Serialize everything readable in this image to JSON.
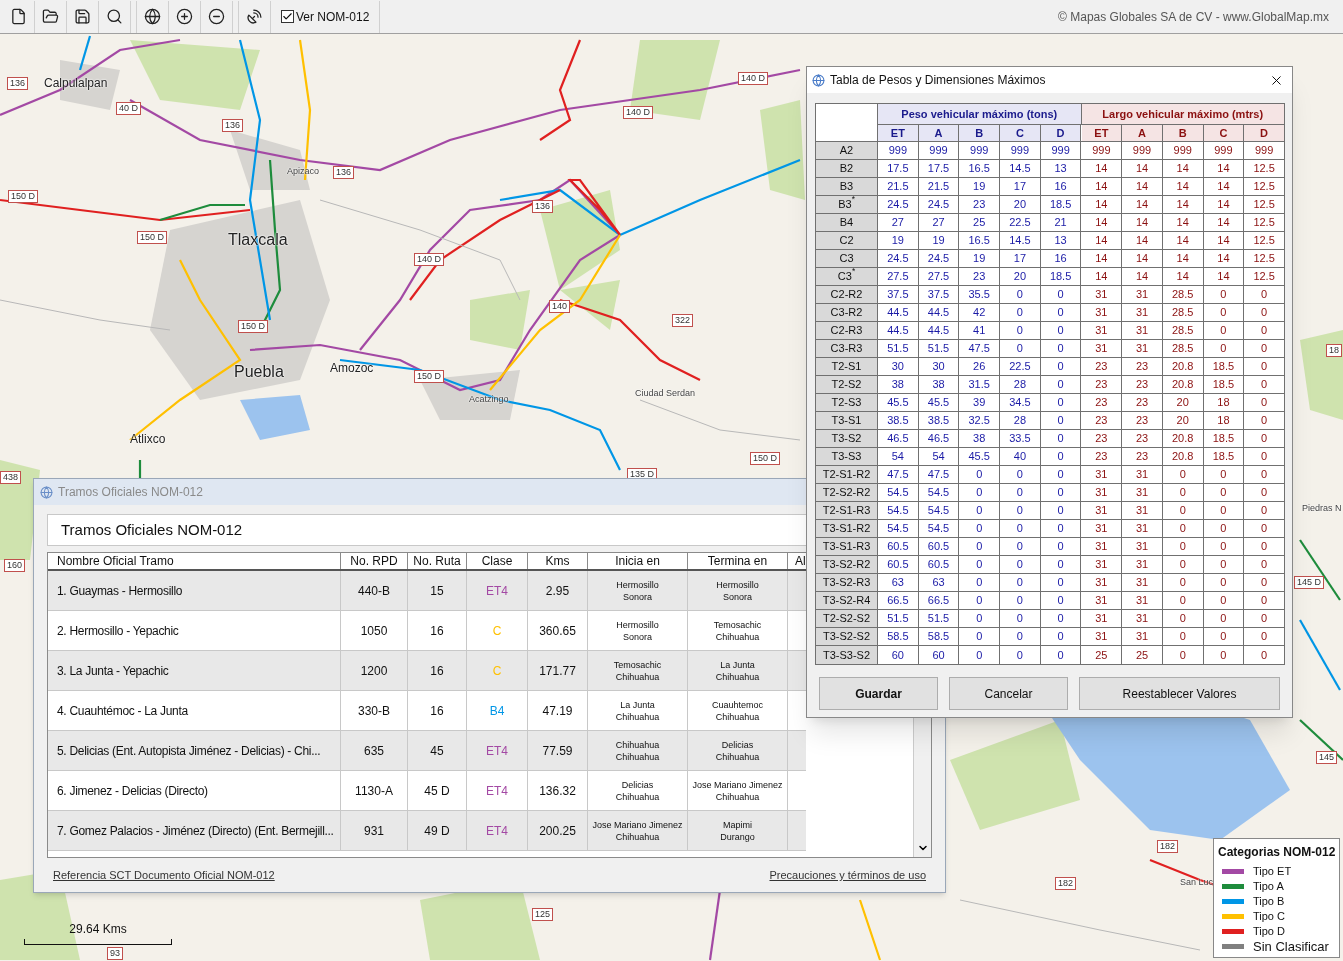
{
  "toolbar": {
    "checkbox": {
      "label": "Ver NOM-012",
      "checked": true
    },
    "copyright": "© Mapas Globales SA de CV - www.GlobalMap.mx"
  },
  "map": {
    "labels": [
      {
        "kind": "city",
        "text": "Calpulalpan"
      },
      {
        "kind": "bigcity",
        "text": "Tlaxcala"
      },
      {
        "kind": "bigcity",
        "text": "Puebla"
      },
      {
        "kind": "city",
        "text": "Amozoc"
      },
      {
        "kind": "city",
        "text": "Atlixco"
      },
      {
        "kind": "town",
        "text": "Apizaco"
      },
      {
        "kind": "town",
        "text": "Acatzingo"
      },
      {
        "kind": "town",
        "text": "Ciudad Serdan"
      },
      {
        "kind": "town",
        "text": "Piedras N"
      },
      {
        "kind": "town",
        "text": "San Luc"
      },
      {
        "kind": "shield",
        "text": "136"
      },
      {
        "kind": "shield",
        "text": "40 D"
      },
      {
        "kind": "shield",
        "text": "136"
      },
      {
        "kind": "shield",
        "text": "136"
      },
      {
        "kind": "shield",
        "text": "140 D"
      },
      {
        "kind": "shield",
        "text": "140 D"
      },
      {
        "kind": "shield",
        "text": "150 D"
      },
      {
        "kind": "shield",
        "text": "150 D"
      },
      {
        "kind": "shield",
        "text": "136"
      },
      {
        "kind": "shield",
        "text": "140 D"
      },
      {
        "kind": "shield",
        "text": "150 D"
      },
      {
        "kind": "shield",
        "text": "140"
      },
      {
        "kind": "shield",
        "text": "322"
      },
      {
        "kind": "shield",
        "text": "150 D"
      },
      {
        "kind": "shield",
        "text": "150 D"
      },
      {
        "kind": "shield",
        "text": "135 D"
      },
      {
        "kind": "shield",
        "text": "438"
      },
      {
        "kind": "shield",
        "text": "160"
      },
      {
        "kind": "shield",
        "text": "125"
      },
      {
        "kind": "shield",
        "text": "93"
      },
      {
        "kind": "shield",
        "text": "182"
      },
      {
        "kind": "shield",
        "text": "182"
      },
      {
        "kind": "shield",
        "text": "145 D"
      },
      {
        "kind": "shield",
        "text": "145"
      },
      {
        "kind": "shield",
        "text": "18"
      }
    ],
    "scale": "29.64 Kms"
  },
  "legend": {
    "title": "Categorias NOM-012",
    "items": [
      {
        "label": "Tipo ET",
        "color": "#a349a4"
      },
      {
        "label": "Tipo A",
        "color": "#1e8c3c"
      },
      {
        "label": "Tipo B",
        "color": "#0096e6"
      },
      {
        "label": "Tipo C",
        "color": "#ffc000"
      },
      {
        "label": "Tipo D",
        "color": "#e02020"
      },
      {
        "label": "Sin Clasificar",
        "color": "#808080"
      }
    ]
  },
  "tramos_window": {
    "title": "Tramos Oficiales NOM-012",
    "heading": "Tramos Oficiales NOM-012",
    "columns": [
      "Nombre Oficial Tramo",
      "No. RPD",
      "No. Ruta",
      "Clase",
      "Kms",
      "Inicia en",
      "Termina en",
      "Al"
    ],
    "rows": [
      {
        "name": "1.  Guaymas - Hermosillo",
        "rpd": "440-B",
        "ruta": "15",
        "clase": "ET4",
        "color": "#a349a4",
        "kms": "2.95",
        "inicia": [
          "Hermosillo",
          "Sonora"
        ],
        "termina": [
          "Hermosillo",
          "Sonora"
        ]
      },
      {
        "name": "2.  Hermosillo - Yepachic",
        "rpd": "1050",
        "ruta": "16",
        "clase": "C",
        "color": "#ffc000",
        "kms": "360.65",
        "inicia": [
          "Hermosillo",
          "Sonora"
        ],
        "termina": [
          "Temosachic",
          "Chihuahua"
        ]
      },
      {
        "name": "3.  La Junta - Yepachic",
        "rpd": "1200",
        "ruta": "16",
        "clase": "C",
        "color": "#ffc000",
        "kms": "171.77",
        "inicia": [
          "Temosachic",
          "Chihuahua"
        ],
        "termina": [
          "La Junta",
          "Chihuahua"
        ]
      },
      {
        "name": "4.  Cuauhtémoc - La Junta",
        "rpd": "330-B",
        "ruta": "16",
        "clase": "B4",
        "color": "#0096e6",
        "kms": "47.19",
        "inicia": [
          "La Junta",
          "Chihuahua"
        ],
        "termina": [
          "Cuauhtemoc",
          "Chihuahua"
        ]
      },
      {
        "name": "5.  Delicias (Ent. Autopista Jiménez - Delicias) - Chi...",
        "rpd": "635",
        "ruta": "45",
        "clase": "ET4",
        "color": "#a349a4",
        "kms": "77.59",
        "inicia": [
          "Chihuahua",
          "Chihuahua"
        ],
        "termina": [
          "Delicias",
          "Chihuahua"
        ]
      },
      {
        "name": "6.  Jimenez - Delicias (Directo)",
        "rpd": "1130-A",
        "ruta": "45 D",
        "clase": "ET4",
        "color": "#a349a4",
        "kms": "136.32",
        "inicia": [
          "Delicias",
          "Chihuahua"
        ],
        "termina": [
          "Jose Mariano Jimenez",
          "Chihuahua"
        ]
      },
      {
        "name": "7.  Gomez Palacios - Jiménez (Directo) (Ent. Bermejill...",
        "rpd": "931",
        "ruta": "49 D",
        "clase": "ET4",
        "color": "#a349a4",
        "kms": "200.25",
        "inicia": [
          "Jose Mariano Jimenez",
          "Chihuahua"
        ],
        "termina": [
          "Mapimi",
          "Durango"
        ]
      }
    ],
    "links": [
      "Referencia SCT Documento Oficial NOM-012",
      "Precauciones y términos de uso"
    ]
  },
  "dialog": {
    "title": "Tabla de Pesos y Dimensiones Máximos",
    "groups": [
      {
        "kind": "weight",
        "title": "Peso vehicular máximo (tons)",
        "columns": [
          "ET",
          "A",
          "B",
          "C",
          "D"
        ]
      },
      {
        "kind": "length",
        "title": "Largo vehicular máximo (mtrs)",
        "columns": [
          "ET",
          "A",
          "B",
          "C",
          "D"
        ]
      }
    ],
    "rows": [
      {
        "label": "A2",
        "values": [
          [
            "999",
            "999",
            "999",
            "999",
            "999"
          ],
          [
            "999",
            "999",
            "999",
            "999",
            "999"
          ]
        ]
      },
      {
        "label": "B2",
        "values": [
          [
            "17.5",
            "17.5",
            "16.5",
            "14.5",
            "13"
          ],
          [
            "14",
            "14",
            "14",
            "14",
            "12.5"
          ]
        ]
      },
      {
        "label": "B3",
        "values": [
          [
            "21.5",
            "21.5",
            "19",
            "17",
            "16"
          ],
          [
            "14",
            "14",
            "14",
            "14",
            "12.5"
          ]
        ]
      },
      {
        "label": "B3$^{*}$",
        "values": [
          [
            "24.5",
            "24.5",
            "23",
            "20",
            "18.5"
          ],
          [
            "14",
            "14",
            "14",
            "14",
            "12.5"
          ]
        ]
      },
      {
        "label": "B4",
        "values": [
          [
            "27",
            "27",
            "25",
            "22.5",
            "21"
          ],
          [
            "14",
            "14",
            "14",
            "14",
            "12.5"
          ]
        ]
      },
      {
        "label": "C2",
        "values": [
          [
            "19",
            "19",
            "16.5",
            "14.5",
            "13"
          ],
          [
            "14",
            "14",
            "14",
            "14",
            "12.5"
          ]
        ]
      },
      {
        "label": "C3",
        "values": [
          [
            "24.5",
            "24.5",
            "19",
            "17",
            "16"
          ],
          [
            "14",
            "14",
            "14",
            "14",
            "12.5"
          ]
        ]
      },
      {
        "label": "C3$^{*}$",
        "values": [
          [
            "27.5",
            "27.5",
            "23",
            "20",
            "18.5"
          ],
          [
            "14",
            "14",
            "14",
            "14",
            "12.5"
          ]
        ]
      },
      {
        "label": "C2-R2",
        "values": [
          [
            "37.5",
            "37.5",
            "35.5",
            "0",
            "0"
          ],
          [
            "31",
            "31",
            "28.5",
            "0",
            "0"
          ]
        ]
      },
      {
        "label": "C3-R2",
        "values": [
          [
            "44.5",
            "44.5",
            "42",
            "0",
            "0"
          ],
          [
            "31",
            "31",
            "28.5",
            "0",
            "0"
          ]
        ]
      },
      {
        "label": "C2-R3",
        "values": [
          [
            "44.5",
            "44.5",
            "41",
            "0",
            "0"
          ],
          [
            "31",
            "31",
            "28.5",
            "0",
            "0"
          ]
        ]
      },
      {
        "label": "C3-R3",
        "values": [
          [
            "51.5",
            "51.5",
            "47.5",
            "0",
            "0"
          ],
          [
            "31",
            "31",
            "28.5",
            "0",
            "0"
          ]
        ]
      },
      {
        "label": "T2-S1",
        "values": [
          [
            "30",
            "30",
            "26",
            "22.5",
            "0"
          ],
          [
            "23",
            "23",
            "20.8",
            "18.5",
            "0"
          ]
        ]
      },
      {
        "label": "T2-S2",
        "values": [
          [
            "38",
            "38",
            "31.5",
            "28",
            "0"
          ],
          [
            "23",
            "23",
            "20.8",
            "18.5",
            "0"
          ]
        ]
      },
      {
        "label": "T2-S3",
        "values": [
          [
            "45.5",
            "45.5",
            "39",
            "34.5",
            "0"
          ],
          [
            "23",
            "23",
            "20",
            "18",
            "0"
          ]
        ]
      },
      {
        "label": "T3-S1",
        "values": [
          [
            "38.5",
            "38.5",
            "32.5",
            "28",
            "0"
          ],
          [
            "23",
            "23",
            "20",
            "18",
            "0"
          ]
        ]
      },
      {
        "label": "T3-S2",
        "values": [
          [
            "46.5",
            "46.5",
            "38",
            "33.5",
            "0"
          ],
          [
            "23",
            "23",
            "20.8",
            "18.5",
            "0"
          ]
        ]
      },
      {
        "label": "T3-S3",
        "values": [
          [
            "54",
            "54",
            "45.5",
            "40",
            "0"
          ],
          [
            "23",
            "23",
            "20.8",
            "18.5",
            "0"
          ]
        ]
      },
      {
        "label": "T2-S1-R2",
        "values": [
          [
            "47.5",
            "47.5",
            "0",
            "0",
            "0"
          ],
          [
            "31",
            "31",
            "0",
            "0",
            "0"
          ]
        ]
      },
      {
        "label": "T2-S2-R2",
        "values": [
          [
            "54.5",
            "54.5",
            "0",
            "0",
            "0"
          ],
          [
            "31",
            "31",
            "0",
            "0",
            "0"
          ]
        ]
      },
      {
        "label": "T2-S1-R3",
        "values": [
          [
            "54.5",
            "54.5",
            "0",
            "0",
            "0"
          ],
          [
            "31",
            "31",
            "0",
            "0",
            "0"
          ]
        ]
      },
      {
        "label": "T3-S1-R2",
        "values": [
          [
            "54.5",
            "54.5",
            "0",
            "0",
            "0"
          ],
          [
            "31",
            "31",
            "0",
            "0",
            "0"
          ]
        ]
      },
      {
        "label": "T3-S1-R3",
        "values": [
          [
            "60.5",
            "60.5",
            "0",
            "0",
            "0"
          ],
          [
            "31",
            "31",
            "0",
            "0",
            "0"
          ]
        ]
      },
      {
        "label": "T3-S2-R2",
        "values": [
          [
            "60.5",
            "60.5",
            "0",
            "0",
            "0"
          ],
          [
            "31",
            "31",
            "0",
            "0",
            "0"
          ]
        ]
      },
      {
        "label": "T3-S2-R3",
        "values": [
          [
            "63",
            "63",
            "0",
            "0",
            "0"
          ],
          [
            "31",
            "31",
            "0",
            "0",
            "0"
          ]
        ]
      },
      {
        "label": "T3-S2-R4",
        "values": [
          [
            "66.5",
            "66.5",
            "0",
            "0",
            "0"
          ],
          [
            "31",
            "31",
            "0",
            "0",
            "0"
          ]
        ]
      },
      {
        "label": "T2-S2-S2",
        "values": [
          [
            "51.5",
            "51.5",
            "0",
            "0",
            "0"
          ],
          [
            "31",
            "31",
            "0",
            "0",
            "0"
          ]
        ]
      },
      {
        "label": "T3-S2-S2",
        "values": [
          [
            "58.5",
            "58.5",
            "0",
            "0",
            "0"
          ],
          [
            "31",
            "31",
            "0",
            "0",
            "0"
          ]
        ]
      },
      {
        "label": "T3-S3-S2",
        "values": [
          [
            "60",
            "60",
            "0",
            "0",
            "0"
          ],
          [
            "25",
            "25",
            "0",
            "0",
            "0"
          ]
        ]
      }
    ],
    "buttons": [
      {
        "label": "Guardar",
        "kind": "primary"
      },
      {
        "label": "Cancelar",
        "kind": "normal"
      },
      {
        "label": "Reestablecer Valores",
        "kind": "normal"
      }
    ]
  }
}
